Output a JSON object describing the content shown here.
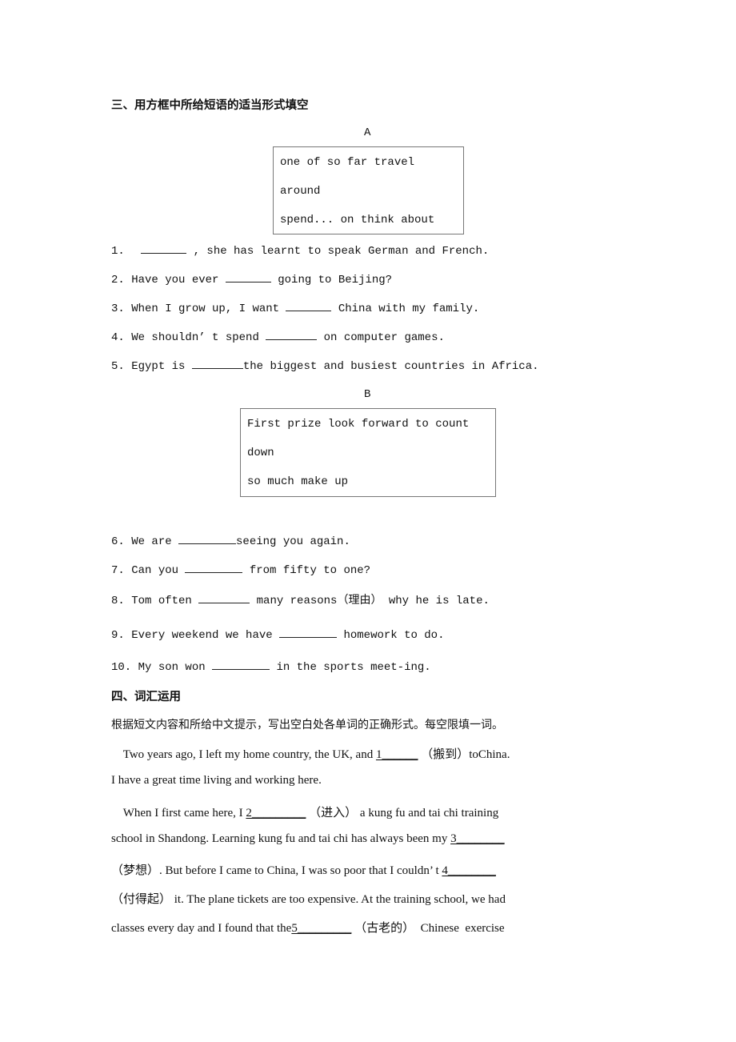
{
  "section3": {
    "title": "三、用方框中所给短语的适当形式填空",
    "boxA": {
      "label": "A",
      "lines": [
        "one  of    so  far    travel",
        "around",
        "spend... on  think about"
      ]
    },
    "questionsA": [
      {
        "num": "1.",
        "before": "",
        "after": " ,  she has learnt to speak German and French."
      },
      {
        "num": "2.",
        "before": "Have you ever ",
        "after": "  going to Beijing?"
      },
      {
        "num": "3.",
        "before": "When I grow up, I want ",
        "after": "  China with my family."
      },
      {
        "num": "4.",
        "before": "We shouldn’ t   spend ",
        "after": "  on  computer games."
      },
      {
        "num": "5.",
        "before": "Egypt is ",
        "after": "the biggest and busiest countries in Africa."
      }
    ],
    "boxB": {
      "label": "B",
      "lines": [
        "First prize   look forward to   count",
        "down",
        "so much  make up"
      ]
    },
    "questionsB": [
      {
        "num": "6.",
        "before": "We are  ",
        "after": "seeing you again."
      },
      {
        "num": "7.",
        "before": "Can you ",
        "after": " from fifty to one?"
      },
      {
        "num": "8.",
        "before": "Tom often ",
        "after": " many reasons（理由） why he is late."
      },
      {
        "num": "9.",
        "before": "Every weekend we have ",
        "after": " homework to do."
      },
      {
        "num": "10.",
        "before": "My son won  ",
        "after": " in the sports meet-ing."
      }
    ]
  },
  "section4": {
    "title": "四、词汇运用",
    "instruction": "根据短文内容和所给中文提示，写出空白处各单词的正确形式。每空限填一词。",
    "passage": [
      {
        "parts": [
          {
            "t": "    Two years ago, I left my home country, the UK, and "
          },
          {
            "blank": "1______"
          },
          {
            "t": " （搬到）toChina."
          }
        ]
      },
      {
        "parts": [
          {
            "t": "I have a great time living and working here."
          }
        ]
      },
      {
        "parts": [
          {
            "t": "    When I first came here, I "
          },
          {
            "blank": "2_________"
          },
          {
            "t": " （进入） a kung fu and tai chi training"
          }
        ]
      },
      {
        "parts": [
          {
            "t": "school in Shandong. Learning kung fu and tai chi has always been my "
          },
          {
            "blank": "3________"
          }
        ]
      },
      {
        "parts": [
          {
            "t": "（梦想）. But before I came to China, I was so poor that I couldn’ t "
          },
          {
            "blank": "4________"
          }
        ]
      },
      {
        "parts": [
          {
            "t": "（付得起） it. The plane tickets are too expensive. At the training school, we had"
          }
        ]
      },
      {
        "parts": [
          {
            "t": "classes every day and I found that the"
          },
          {
            "blank": "5_________"
          },
          {
            "t": " （古老的）  Chinese  exercise"
          }
        ]
      }
    ]
  }
}
